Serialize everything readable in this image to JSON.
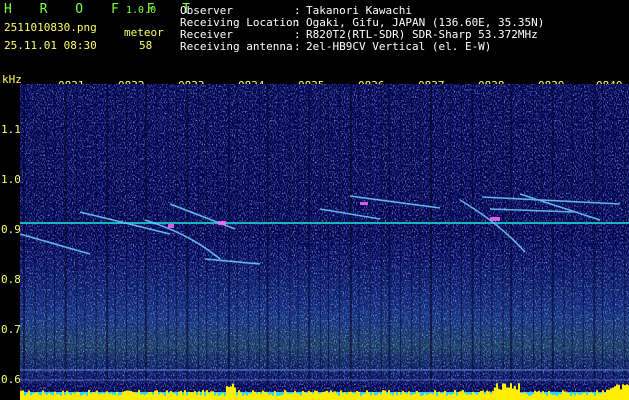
{
  "app": {
    "title": "H R O F F T",
    "version": "1.0.0"
  },
  "file": {
    "name": "2511010830.png",
    "timestamp": "25.11.01 08:30"
  },
  "meteor": {
    "label": "meteor",
    "count": "58"
  },
  "info": [
    {
      "key": "Observer",
      "sep": ":",
      "value": "Takanori Kawachi"
    },
    {
      "key": "Receiving Location",
      "sep": ":",
      "value": "Ogaki, Gifu, JAPAN (136.60E, 35.35N)"
    },
    {
      "key": "Receiver",
      "sep": ":",
      "value": "R820T2(RTL-SDR) SDR-Sharp 53.372MHz"
    },
    {
      "key": "Receiving antenna",
      "sep": ":",
      "value": "2el-HB9CV Vertical (el. E-W)"
    }
  ],
  "axis": {
    "unit": "kHz",
    "time_ticks": [
      "0831",
      "0832",
      "0833",
      "0834",
      "0835",
      "0836",
      "0837",
      "0838",
      "0839",
      "0840"
    ],
    "freq_ticks": [
      "1.1",
      "1.0",
      "0.9",
      "0.8",
      "0.7",
      "0.6"
    ]
  },
  "colors": {
    "background": "#000000",
    "spectrum_bg": "#000052",
    "accent_green": "#7dff3c",
    "accent_yellow": "#ffff66",
    "carrier": "#19c8c8",
    "meteor_trail": "#6cc6ff",
    "level_bar": "#ffee00",
    "baseline": "#2ad8ff"
  }
}
